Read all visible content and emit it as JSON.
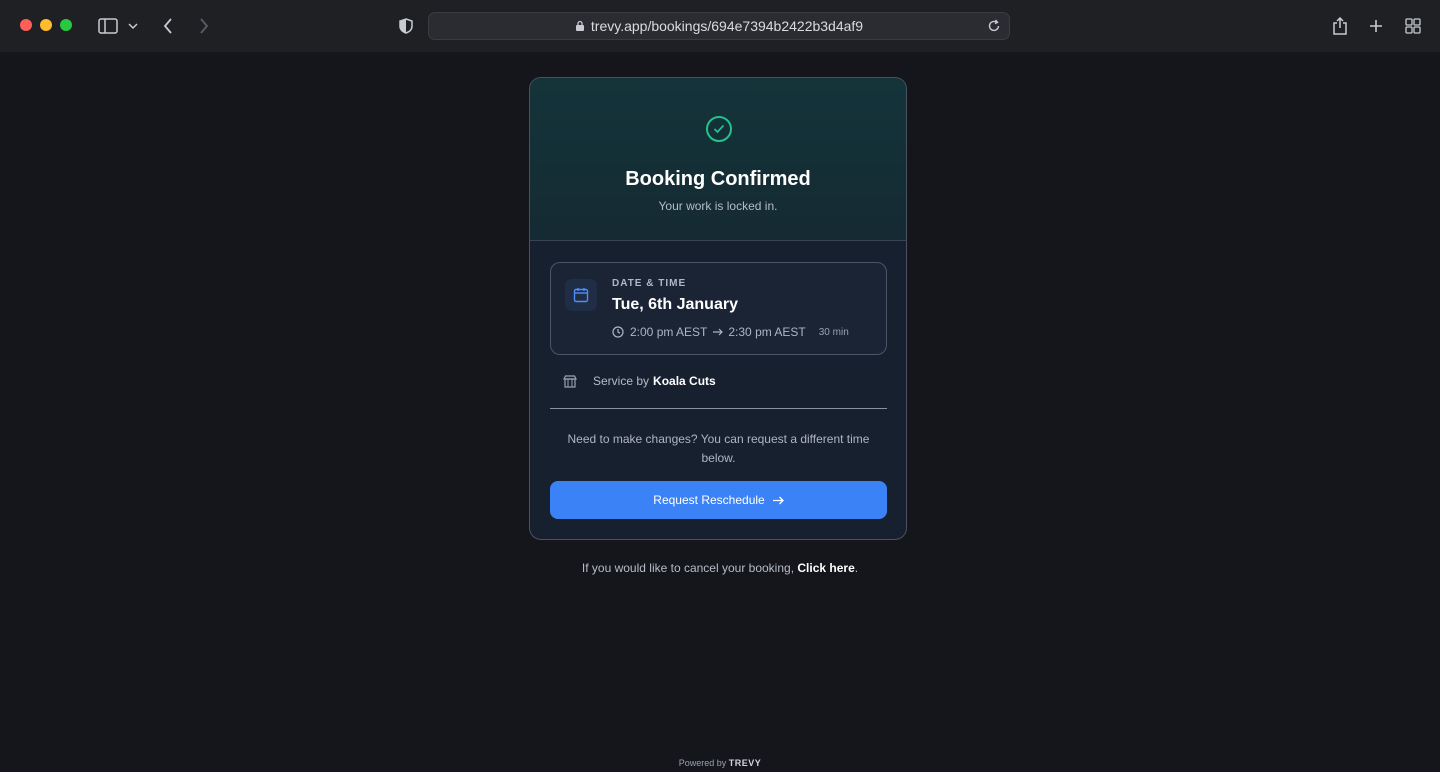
{
  "browser": {
    "url": "trevy.app/bookings/694e7394b2422b3d4af9",
    "icons": [
      "sidebar-icon",
      "chevron-down-icon",
      "back-icon",
      "forward-icon",
      "shield-icon",
      "lock-icon",
      "reload-icon",
      "share-icon",
      "new-tab-icon",
      "tab-overview-icon"
    ]
  },
  "card": {
    "title": "Booking Confirmed",
    "subtitle": "Your work is locked in.",
    "datetime_label": "DATE & TIME",
    "date": "Tue, 6th January",
    "start_time": "2:00 pm AEST",
    "end_time": "2:30 pm AEST",
    "duration": "30 min",
    "service_prefix": "Service by",
    "provider": "Koala Cuts",
    "help_text": "Need to make changes? You can request a different time below.",
    "button_label": "Request Reschedule"
  },
  "cancel": {
    "text": "If you would like to cancel your booking,",
    "link": "Click here",
    "suffix": "."
  },
  "footer": {
    "prefix": "Powered by",
    "brand": "TREVY"
  },
  "colors": {
    "accent": "#3b82f6",
    "success": "#22c38a",
    "background": "#14161b"
  }
}
